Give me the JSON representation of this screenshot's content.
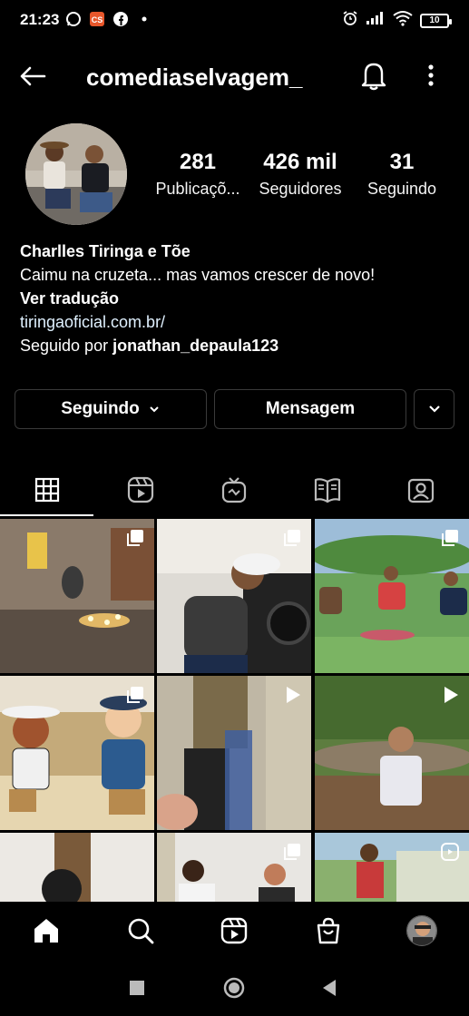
{
  "status_bar": {
    "time": "21:23",
    "battery": "10",
    "left_icons": [
      "whatsapp-icon",
      "cs-app-icon",
      "facebook-icon",
      "dot-icon"
    ],
    "right_icons": [
      "alarm-icon",
      "signal-icon",
      "wifi-icon",
      "battery-icon"
    ]
  },
  "header": {
    "username": "comediaselvagem_",
    "icons": [
      "back-arrow-icon",
      "bell-icon",
      "more-vertical-icon"
    ]
  },
  "profile": {
    "stats": [
      {
        "value": "281",
        "label": "Publicaçõ..."
      },
      {
        "value": "426 mil",
        "label": "Seguidores"
      },
      {
        "value": "31",
        "label": "Seguindo"
      }
    ],
    "name": "Charlles Tiringa e Tõe",
    "bio": "Caimu na cruzeta... mas vamos crescer de novo!",
    "translate": "Ver tradução",
    "link": "tiringaoficial.com.br/",
    "followed_by_prefix": "Seguido por ",
    "followed_by_user": "jonathan_depaula123"
  },
  "actions": {
    "following_label": "Seguindo",
    "message_label": "Mensagem"
  },
  "tabs": [
    "grid-icon",
    "reels-icon",
    "igtv-icon",
    "guides-icon",
    "tagged-icon"
  ],
  "grid": {
    "tiles": [
      {
        "badge": "multiple-posts-icon"
      },
      {
        "badge": "multiple-posts-icon"
      },
      {
        "badge": "multiple-posts-icon"
      },
      {
        "badge": "multiple-posts-icon"
      },
      {
        "badge": "play-icon"
      },
      {
        "badge": "play-icon"
      },
      {
        "badge": "none"
      },
      {
        "badge": "multiple-posts-icon"
      },
      {
        "badge": "reels-icon"
      }
    ]
  },
  "bottom_nav": [
    "home-icon",
    "search-icon",
    "reels-icon",
    "shop-icon",
    "profile-avatar"
  ],
  "system_nav": [
    "recents-icon",
    "home-circle-icon",
    "back-triangle-icon"
  ]
}
